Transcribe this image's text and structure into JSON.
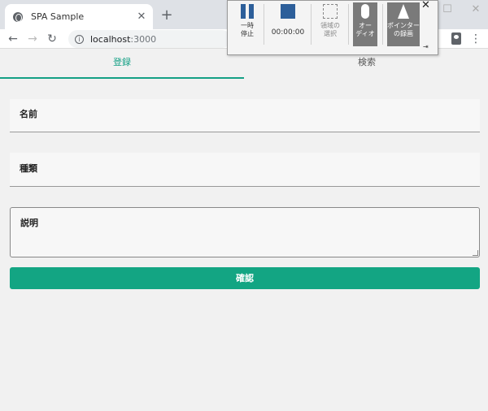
{
  "browser": {
    "tab_title": "SPA Sample",
    "tab_close": "✕",
    "new_tab": "+",
    "window_controls": {
      "minimize": "—",
      "maximize": "☐",
      "close": "✕"
    },
    "nav": {
      "back": "←",
      "forward": "→",
      "reload": "↻"
    },
    "address": {
      "host": "localhost",
      "port": ":3000",
      "info": "i"
    },
    "menu": "⋮"
  },
  "recorder": {
    "pause_label": "一時\n停止",
    "pause_label_line1": "一時",
    "pause_label_line2": "停止",
    "timer": "00:00:00",
    "region_line1": "領域の",
    "region_line2": "選択",
    "audio_line1": "オー",
    "audio_line2": "ディオ",
    "pointer_line1": "ポインター",
    "pointer_line2": "の録画",
    "close": "✕"
  },
  "app": {
    "tabs": [
      {
        "label": "登録",
        "active": true
      },
      {
        "label": "検索",
        "active": false
      }
    ],
    "form": {
      "name_label": "名前",
      "type_label": "種類",
      "description_label": "説明",
      "confirm_label": "確認"
    }
  },
  "colors": {
    "accent": "#14a085",
    "button": "#13a583",
    "recorder_icon": "#2d5f9a"
  }
}
